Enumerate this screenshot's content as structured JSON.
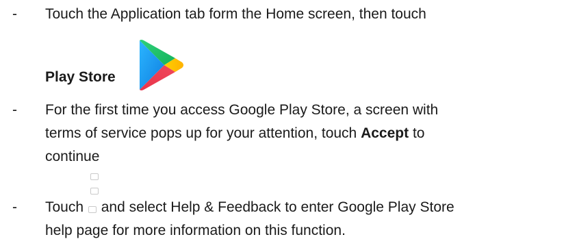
{
  "doc": {
    "bullet": "-",
    "item1": {
      "text": "Touch the Application tab form the Home screen, then touch",
      "bold_label": "Play Store",
      "icon": "google-play-store-icon"
    },
    "item2": {
      "line1": "For the first time you access Google Play Store, a screen with",
      "line2_pre": "terms of service pops up for your attention, touch ",
      "line2_bold": "Accept",
      "line2_post": " to",
      "line3": "continue"
    },
    "item3": {
      "pre": "Touch ",
      "icon": "menu-dots-icon",
      "post": " and select Help & Feedback to enter Google Play Store",
      "line2": "help page for more information on this function."
    }
  }
}
